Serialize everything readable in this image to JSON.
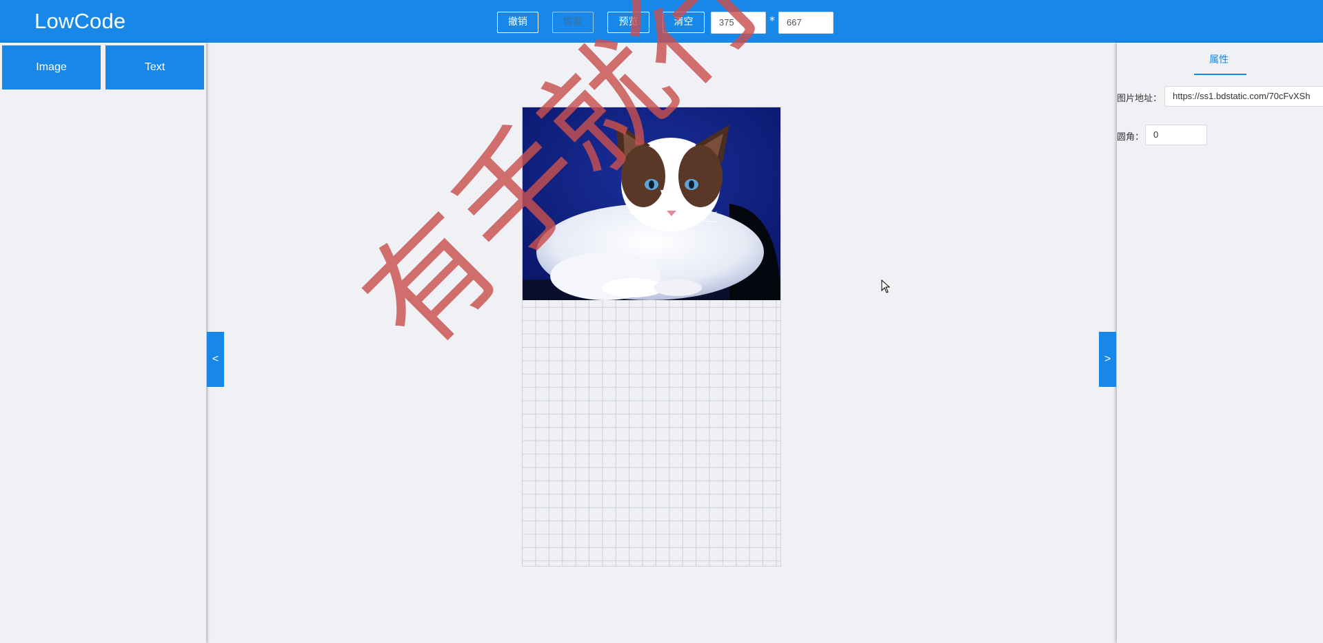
{
  "header": {
    "logo": "LowCode",
    "undo_label": "撤销",
    "redo_label": "恢复",
    "preview_label": "预览",
    "clear_label": "清空",
    "width_value": "375",
    "times_symbol": "*",
    "height_value": "667"
  },
  "components": {
    "items": [
      {
        "label": "Image"
      },
      {
        "label": "Text"
      }
    ]
  },
  "toggles": {
    "left_label": "<",
    "right_label": ">"
  },
  "properties": {
    "tab_label": "属性",
    "image_url_label": "图片地址：",
    "image_url_value": "https://ss1.bdstatic.com/70cFvXSh",
    "radius_label": "圆角：",
    "radius_value": "0"
  },
  "watermark": {
    "text": "有手就行"
  },
  "colors": {
    "primary": "#1888e8",
    "background": "#f0f1f5",
    "watermark": "#c85050"
  }
}
